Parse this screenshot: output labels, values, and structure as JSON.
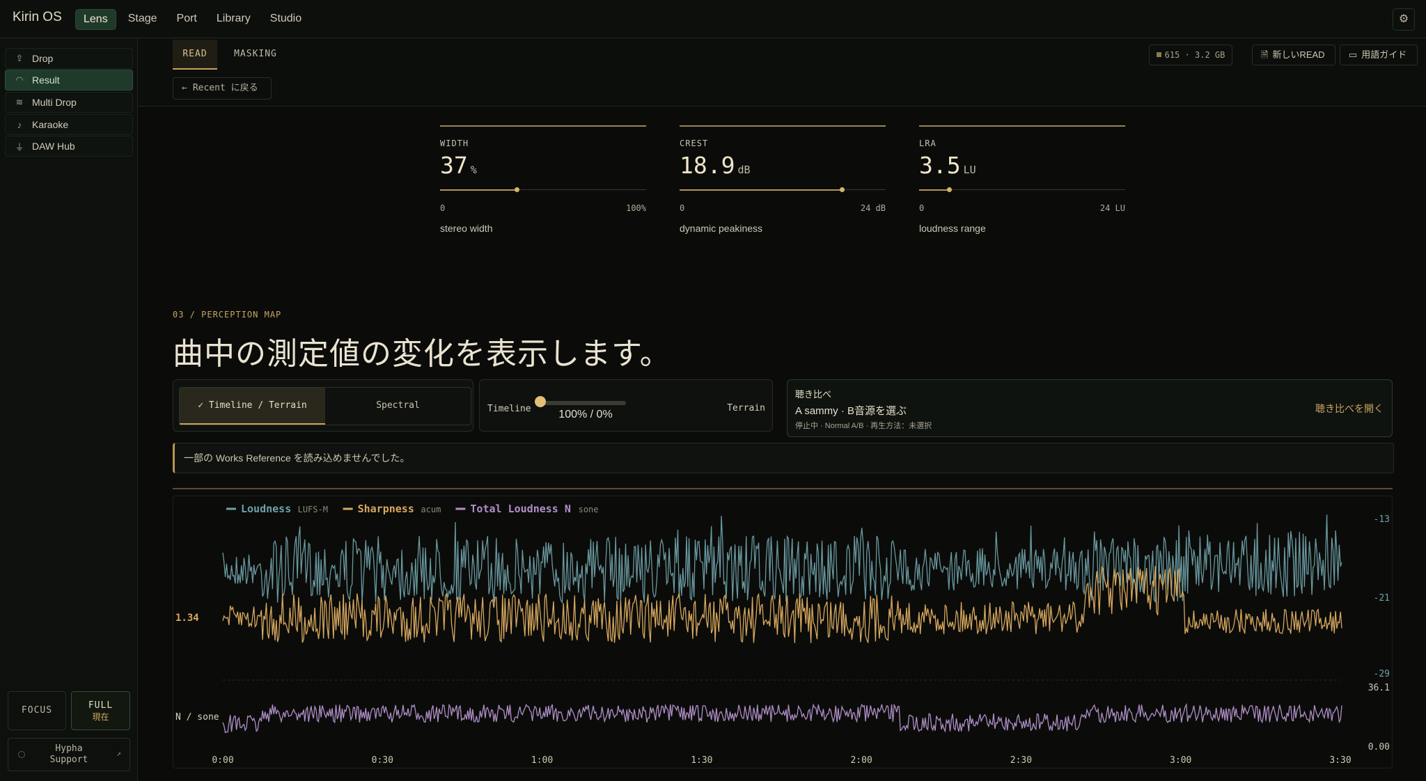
{
  "app": {
    "brand": "Kirin OS",
    "top_nav": [
      "Lens",
      "Stage",
      "Port",
      "Library",
      "Studio"
    ],
    "active_top_nav": "Lens",
    "settings_icon": "gear-icon"
  },
  "sidebar": {
    "items": [
      {
        "label": "Drop",
        "icon": "upload-icon"
      },
      {
        "label": "Result",
        "icon": "gauge-icon"
      },
      {
        "label": "Multi Drop",
        "icon": "layers-icon"
      },
      {
        "label": "Karaoke",
        "icon": "mic-icon"
      },
      {
        "label": "DAW Hub",
        "icon": "plug-icon"
      }
    ],
    "active": "Result",
    "focus_label": "FOCUS",
    "full_label": "FULL",
    "full_sublabel": "現在",
    "support_line1": "Hypha",
    "support_line2": "Support"
  },
  "header": {
    "tabs": [
      "READ",
      "MASKING"
    ],
    "active_tab": "READ",
    "back_label": "Recent に戻る",
    "stats": "615 · 3.2 GB",
    "new_read_label": "新しいREAD",
    "guide_label": "用語ガイド"
  },
  "metrics": [
    {
      "label": "WIDTH",
      "value": "37",
      "unit": "%",
      "level": 0.37,
      "min": "0",
      "max": "100%",
      "desc": "stereo width"
    },
    {
      "label": "CREST",
      "value": "18.9",
      "unit": "dB",
      "level": 0.7875,
      "min": "0",
      "max": "24 dB",
      "desc": "dynamic peakiness"
    },
    {
      "label": "LRA",
      "value": "3.5",
      "unit": "LU",
      "level": 0.146,
      "min": "0",
      "max": "24 LU",
      "desc": "loudness range"
    }
  ],
  "section": {
    "eyebrow": "03 / PERCEPTION MAP",
    "title": "曲中の測定値の変化を表示します。"
  },
  "controls": {
    "mode_options": [
      "Timeline / Terrain",
      "Spectral"
    ],
    "mode_selected": "Timeline / Terrain",
    "slider_left": "Timeline",
    "slider_right": "Terrain",
    "slider_value": "100% / 0%",
    "slider_level": 0,
    "compare_title": "聴き比べ",
    "compare_source": "A sammy · B音源を選ぶ",
    "compare_meta": "停止中 · Normal A/B · 再生方法：未選択",
    "compare_open": "聴き比べを開く"
  },
  "warning": "一部の Works Reference を読み込めませんでした。",
  "colors": {
    "loudness": "#6fa0a8",
    "sharpness": "#d8a85e",
    "total_loudness": "#b08fc8",
    "accent": "#c9a462"
  },
  "chart_data": {
    "type": "line",
    "x_range": [
      "0:00",
      "3:30"
    ],
    "x_ticks": [
      "0:00",
      "0:30",
      "1:00",
      "1:30",
      "2:00",
      "2:30",
      "3:00",
      "3:30"
    ],
    "series": [
      {
        "name": "Loudness",
        "unit": "LUFS-M",
        "axis": "right",
        "ylim": [
          -29,
          -13
        ]
      },
      {
        "name": "Sharpness",
        "unit": "acum",
        "axis": "left",
        "mean_label": "1.34"
      },
      {
        "name": "Total Loudness N",
        "unit": "sone",
        "axis": "right-lower",
        "ylim": [
          0.0,
          36.1
        ]
      }
    ],
    "right_ticks_top": [
      "-13",
      "-21",
      "-29"
    ],
    "right_ticks_bottom": [
      "36.1",
      "0.00"
    ],
    "left_label_top": "1.34",
    "left_label_bottom": "N / sone"
  }
}
